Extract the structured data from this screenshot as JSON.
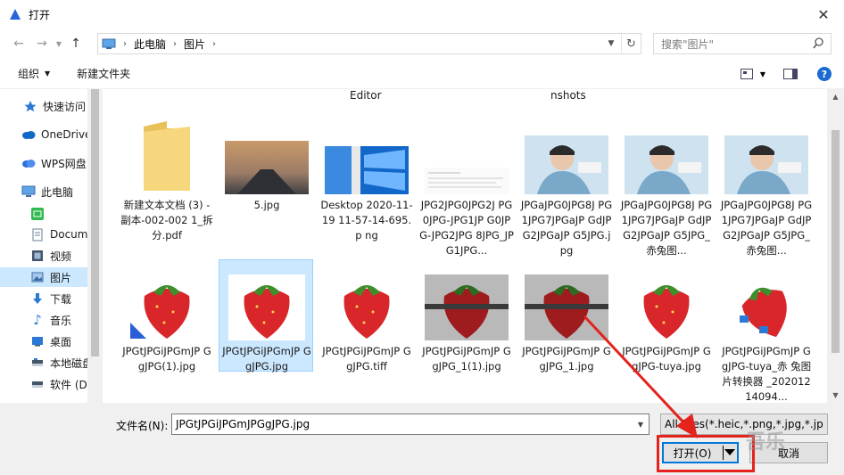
{
  "window": {
    "title": "打开",
    "close": "✕"
  },
  "nav": {
    "breadcrumb": [
      "此电脑",
      "图片"
    ],
    "search_placeholder": "搜索\"图片\""
  },
  "toolbar": {
    "organize": "组织",
    "new_folder": "新建文件夹",
    "help": "?"
  },
  "sidebar": {
    "items": [
      {
        "label": "快速访问",
        "icon": "star-icon"
      },
      {
        "label": "OneDrive",
        "icon": "cloud-icon"
      },
      {
        "label": "WPS网盘",
        "icon": "cloud-icon"
      },
      {
        "label": "此电脑",
        "icon": "computer-icon"
      },
      {
        "label": "",
        "icon": "app-icon"
      },
      {
        "label": "Docum",
        "icon": "document-icon"
      },
      {
        "label": "视频",
        "icon": "video-icon"
      },
      {
        "label": "图片",
        "icon": "pictures-icon"
      },
      {
        "label": "下载",
        "icon": "download-icon"
      },
      {
        "label": "音乐",
        "icon": "music-icon"
      },
      {
        "label": "桌面",
        "icon": "desktop-icon"
      },
      {
        "label": "本地磁盘",
        "icon": "drive-icon"
      },
      {
        "label": "软件 (D",
        "icon": "drive-icon"
      }
    ]
  },
  "content": {
    "cut_labels": [
      "Editor",
      "nshots"
    ],
    "row1": [
      {
        "label": "新建文本文档 (3) - 副本-002-002 1_拆分.pdf",
        "thumb": "folder"
      },
      {
        "label": "5.jpg",
        "thumb": "road"
      },
      {
        "label": "Desktop 2020-11-19 11-57-14-695.p ng",
        "thumb": "desktop"
      },
      {
        "label": "JPG2JPG0JPG2J PG0JPG-JPG1JP G0JPG-JPG2JPG 8JPG_JPG1JPG...",
        "thumb": "doc"
      },
      {
        "label": "JPGaJPG0JPG8J PG1JPG7JPGaJP GdJPG2JPGaJP G5JPG.jpg",
        "thumb": "boy"
      },
      {
        "label": "JPGaJPG0JPG8J PG1JPG7JPGaJP GdJPG2JPGaJP G5JPG_赤兔图...",
        "thumb": "boy"
      },
      {
        "label": "JPGaJPG0JPG8J PG1JPG7JPGaJP GdJPG2JPGaJP G5JPG_赤兔图...",
        "thumb": "boy"
      }
    ],
    "row2": [
      {
        "label": "JPGtJPGiJPGmJP GgJPG(1).jpg",
        "thumb": "straw-badge"
      },
      {
        "label": "JPGtJPGiJPGmJP GgJPG.jpg",
        "thumb": "straw"
      },
      {
        "label": "JPGtJPGiJPGmJP GgJPG.tiff",
        "thumb": "straw"
      },
      {
        "label": "JPGtJPGiJPGmJP GgJPG_1(1).jpg",
        "thumb": "straw-dark"
      },
      {
        "label": "JPGtJPGiJPGmJP GgJPG_1.jpg",
        "thumb": "straw-dark"
      },
      {
        "label": "JPGtJPGiJPGmJP GgJPG-tuya.jpg",
        "thumb": "straw"
      },
      {
        "label": "JPGtJPGiJPGmJP GgJPG-tuya_赤 兔图片转换器 _20201214094...",
        "thumb": "straw-tilt"
      }
    ]
  },
  "bottom": {
    "filename_label": "文件名(N):",
    "filename_value": "JPGtJPGiJPGmJPGgJPG.jpg",
    "filetype_value": "All Files(*.heic,*.png,*.jpg,*.jp",
    "open_label": "打开(O)",
    "cancel_label": "取消"
  },
  "watermark": "吾乐"
}
